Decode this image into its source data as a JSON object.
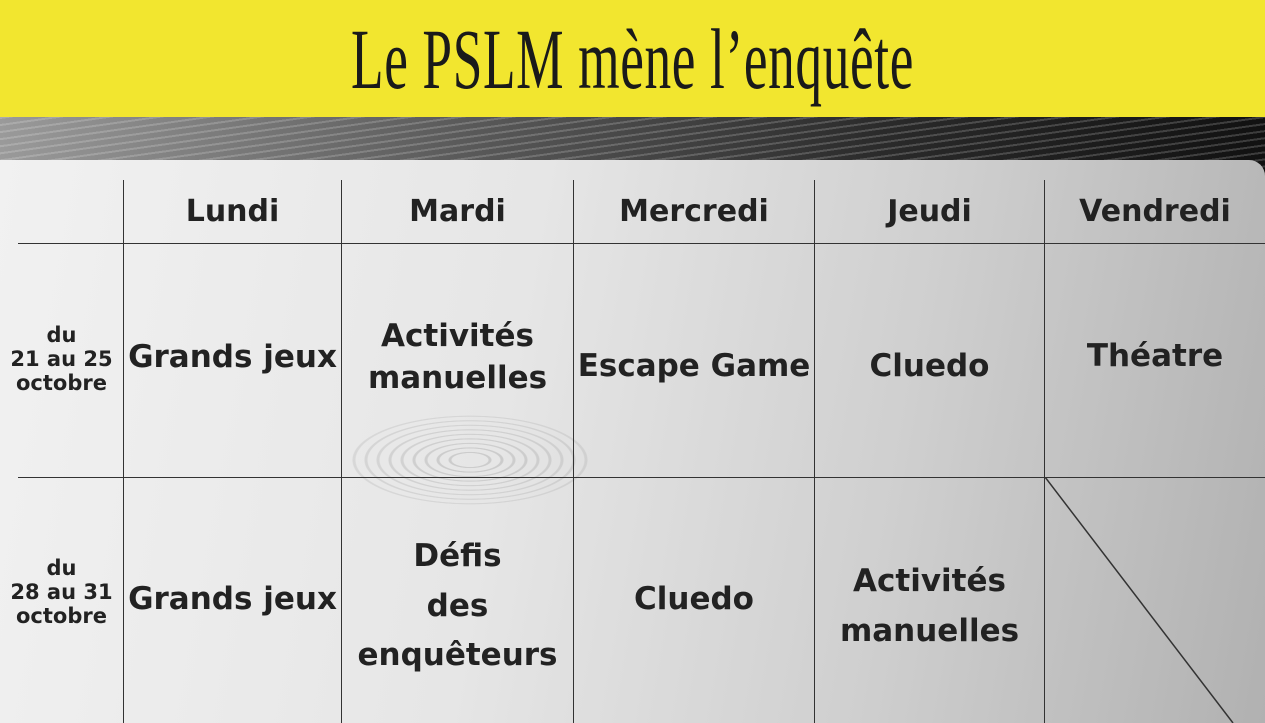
{
  "title": "Le PSLM mène l’enquête",
  "colors": {
    "banner": "#f2e62f",
    "text": "#222222"
  },
  "table": {
    "days": [
      "Lundi",
      "Mardi",
      "Mercredi",
      "Jeudi",
      "Vendredi"
    ],
    "rows": [
      {
        "date": "du\n21 au 25\noctobre",
        "activities": [
          "Grands jeux",
          "Activités\nmanuelles",
          "Escape Game",
          "Cluedo",
          "Théatre"
        ]
      },
      {
        "date": "du\n28 au 31\noctobre",
        "activities": [
          "Grands jeux",
          "Défis\ndes\nenquêteurs",
          "Cluedo",
          "Activités\nmanuelles",
          ""
        ]
      }
    ]
  }
}
